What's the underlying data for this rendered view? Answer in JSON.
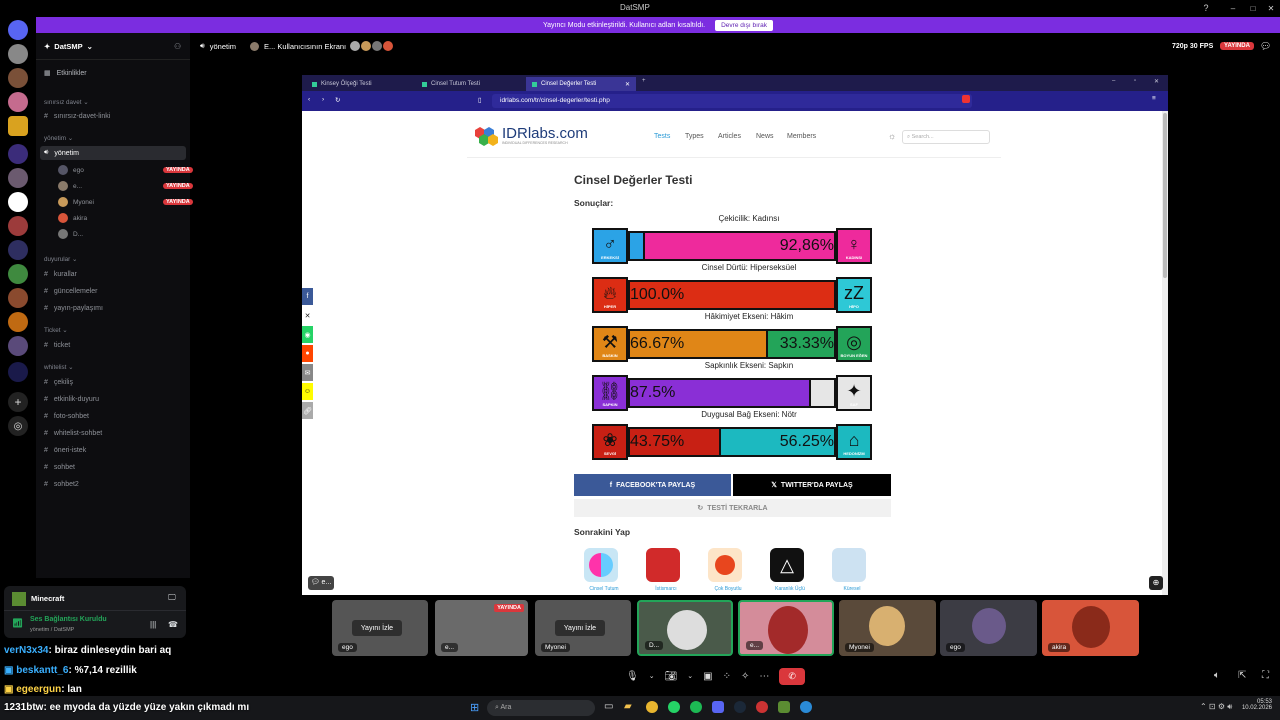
{
  "window": {
    "title": "DatSMP"
  },
  "notification": {
    "text": "Yayıncı Modu etkinleştirildi. Kullanıcı adları kısaltıldı.",
    "button": "Devre dışı bırak"
  },
  "server": {
    "name": "DatSMP"
  },
  "sidebar": {
    "events": "Etkinlikler",
    "invite_header": "sınırsız davet",
    "invite_channel": "sınırsız-davet-linki",
    "mgmt_header": "yönetim",
    "voice_channel": "yönetim",
    "users": [
      {
        "name": "ego",
        "badge": "YAYINDA"
      },
      {
        "name": "e...",
        "badge": "YAYINDA"
      },
      {
        "name": "Myonei",
        "badge": "YAYINDA"
      },
      {
        "name": "akira",
        "badge": ""
      },
      {
        "name": "D...",
        "badge": ""
      }
    ],
    "ann_header": "duyurular",
    "ann_channels": [
      "kurallar",
      "güncellemeler",
      "yayın-paylaşımı"
    ],
    "ticket_header": "Ticket",
    "ticket_channel": "ticket",
    "wl_header": "whitelist",
    "wl_channels": [
      "çekiliş",
      "etkinlik-duyuru",
      "foto-sohbet",
      "whitelist-sohbet",
      "öneri-istek",
      "sohbet",
      "sohbet2"
    ]
  },
  "top": {
    "channel": "yönetim",
    "stream_title": "E... Kullanıcısının Ekranı",
    "quality": "720p 30 FPS",
    "live": "YAYINDA"
  },
  "browser": {
    "tabs": [
      "Kinsey Ölçeği Testi",
      "Cinsel Tutum Testi",
      "Cinsel Değerler Testi"
    ],
    "url": "idrlabs.com/tr/cinsel-degerler/testi.php"
  },
  "site": {
    "logo": "IDRlabs.com",
    "logo_sub": "INDIVIDUAL DIFFERENCES RESEARCH",
    "nav": [
      "Tests",
      "Types",
      "Articles",
      "News",
      "Members"
    ],
    "search_placeholder": "Search...",
    "title": "Cinsel Değerler Testi",
    "results_label": "Sonuçlar:",
    "bars": [
      {
        "title": "Çekicilik: Kadınsı",
        "left_label": "ERKEKSİ",
        "right_label": "KADINSI",
        "left_value": "",
        "right_value": "92,86%",
        "left_pct": 7.14,
        "left_color": "#2ba3e6",
        "right_color": "#ee2a9c"
      },
      {
        "title": "Cinsel Dürtü: Hiperseksüel",
        "left_label": "HİPER",
        "right_label": "HİPO",
        "left_value": "100.0%",
        "right_value": "",
        "left_pct": 100,
        "left_color": "#dc2d14",
        "right_color": "#2ec8d6"
      },
      {
        "title": "Hâkimiyet Ekseni: Hâkim",
        "left_label": "BASKIN",
        "right_label": "BOYUN EĞEN",
        "left_value": "66.67%",
        "right_value": "33.33%",
        "left_pct": 66.67,
        "left_color": "#e08617",
        "right_color": "#23a459"
      },
      {
        "title": "Sapkınlık Ekseni: Sapkın",
        "left_label": "SAPKIN",
        "right_label": "SAF",
        "left_value": "87.5%",
        "right_value": "",
        "left_pct": 87.5,
        "left_color": "#8a2fd6",
        "right_color": "#e6e6e6"
      },
      {
        "title": "Duygusal Bağ Ekseni: Nötr",
        "left_label": "SEVGİ",
        "right_label": "HEDONİZM",
        "left_value": "43.75%",
        "right_value": "56.25%",
        "left_pct": 43.75,
        "left_color": "#c82014",
        "right_color": "#1cb9c0"
      }
    ],
    "fb_share": "FACEBOOK'TA PAYLAŞ",
    "tw_share": "TWITTER'DA PAYLAŞ",
    "retry": "TESTİ TEKRARLA",
    "next_label": "Sonrakini Yap",
    "next_tests": [
      "Cinsel Tutum",
      "İstismarcı",
      "Çok Boyutlu",
      "Karanlık Üçlü",
      "Küresel"
    ]
  },
  "voice_panel": {
    "app": "Minecraft",
    "status": "Ses Bağlantısı Kuruldu",
    "sub": "yönetim / DatSMP"
  },
  "tiles": [
    {
      "label": "ego",
      "watch": "Yayını İzle"
    },
    {
      "label": "e...",
      "live": "YAYINDA"
    },
    {
      "label": "Myonei",
      "watch": "Yayını İzle"
    },
    {
      "label": "D..."
    },
    {
      "label": "e..."
    },
    {
      "label": "Myonei"
    },
    {
      "label": "ego"
    },
    {
      "label": "akira"
    }
  ],
  "chat": [
    {
      "user": "verN3x34",
      "msg": ": biraz dinleseydin bari aq",
      "color": "#3ab0ff"
    },
    {
      "user": "beskantt_6",
      "msg": ": %7,14 rezillik",
      "color": "#3ab0ff"
    },
    {
      "user": "egeergun",
      "msg": ": lan",
      "color": "#ffd447"
    },
    {
      "user": "1231btw",
      "msg": ": ee myoda da yüzde yüze yakın çıkmadı mı",
      "color": "#ffffff"
    }
  ],
  "taskbar": {
    "search": "Ara",
    "time": "05:53",
    "date": "10.02.2026"
  }
}
